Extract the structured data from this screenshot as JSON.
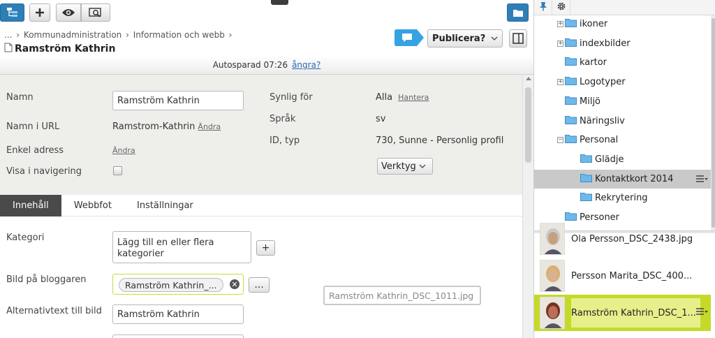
{
  "toolbar": {
    "icons": [
      "structure-icon",
      "add-icon",
      "preview-icon",
      "compare-icon",
      "folder-icon"
    ],
    "colors": {
      "blue_button": "#2e7fb8"
    }
  },
  "breadcrumb": {
    "ellipsis": "...",
    "items": [
      "Kommunadministration",
      "Information och webb"
    ],
    "separator": "›"
  },
  "page": {
    "title": "Ramström Kathrin"
  },
  "publish": {
    "label": "Publicera?"
  },
  "autosave": {
    "text": "Autosparad 07:26",
    "undo": "ångra?"
  },
  "properties": {
    "namn": {
      "label": "Namn",
      "value": "Ramström Kathrin"
    },
    "url": {
      "label": "Namn i URL",
      "value": "Ramstrom-Kathrin",
      "link": "Ändra"
    },
    "simple_address": {
      "label": "Enkel adress",
      "link": "Ändra"
    },
    "nav": {
      "label": "Visa i navigering"
    },
    "visible_for": {
      "label": "Synlig för",
      "value": "Alla",
      "link": "Hantera"
    },
    "language": {
      "label": "Språk",
      "value": "sv"
    },
    "id_type": {
      "label": "ID, typ",
      "value": "730, Sunne - Personlig profil"
    },
    "tools": {
      "label": "Verktyg"
    }
  },
  "tabs": [
    {
      "label": "Innehåll",
      "active": true
    },
    {
      "label": "Webbfot",
      "active": false
    },
    {
      "label": "Inställningar",
      "active": false
    }
  ],
  "content": {
    "category": {
      "label": "Kategori",
      "placeholder": "Lägg till en eller flera kategorier",
      "add_label": "+"
    },
    "image": {
      "label": "Bild på bloggaren",
      "chip": "Ramström Kathrin_...",
      "clear": "✕",
      "browse_label": "..."
    },
    "alt_text": {
      "label": "Alternativtext till bild",
      "value": "Ramström Kathrin"
    },
    "drag_ghost": "Ramström Kathrin_DSC_1011.jpg"
  },
  "folders": [
    {
      "name": "ikoner",
      "level": 1,
      "expander": "+"
    },
    {
      "name": "indexbilder",
      "level": 1,
      "expander": "+"
    },
    {
      "name": "kartor",
      "level": 1,
      "expander": ""
    },
    {
      "name": "Logotyper",
      "level": 1,
      "expander": "+"
    },
    {
      "name": "Miljö",
      "level": 1,
      "expander": ""
    },
    {
      "name": "Näringsliv",
      "level": 1,
      "expander": ""
    },
    {
      "name": "Personal",
      "level": 1,
      "expander": "−"
    },
    {
      "name": "Glädje",
      "level": 2,
      "expander": ""
    },
    {
      "name": "Kontaktkort 2014",
      "level": 2,
      "expander": "",
      "selected": true
    },
    {
      "name": "Rekrytering",
      "level": 2,
      "expander": ""
    },
    {
      "name": "Personer",
      "level": 1,
      "expander": ""
    }
  ],
  "files": [
    {
      "name": "Ola Persson_DSC_2438.jpg"
    },
    {
      "name": "Persson Marita_DSC_400..."
    },
    {
      "name": "Ramström Kathrin_DSC_1...",
      "selected": true
    }
  ],
  "colors": {
    "selected_file": "#c5d928",
    "link": "#2b6bb5",
    "folder": "#4aa3df"
  }
}
